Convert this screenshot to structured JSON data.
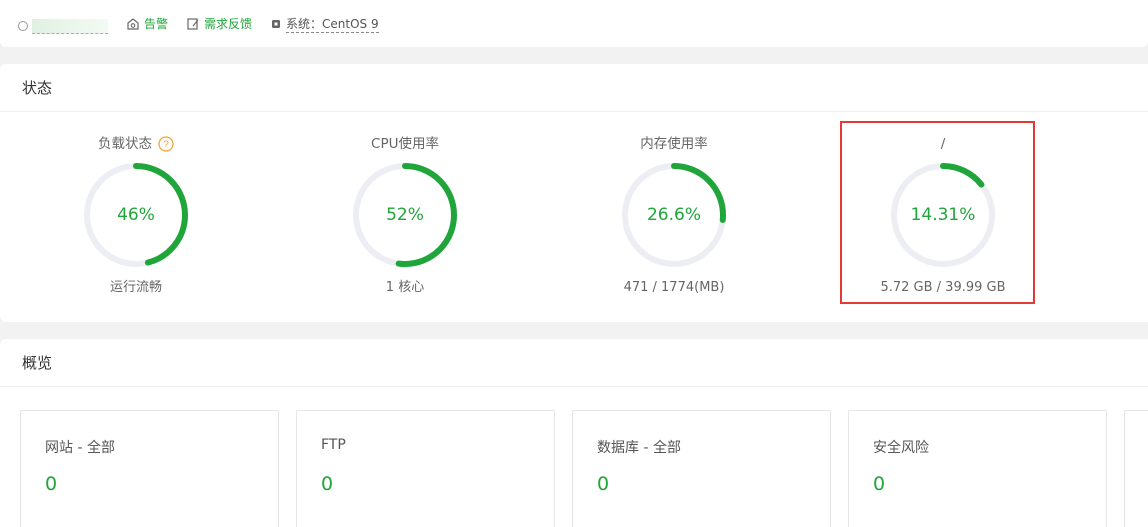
{
  "topbar": {
    "alarm_label": "告警",
    "feedback_label": "需求反馈",
    "system_label": "系统：CentOS 9"
  },
  "status": {
    "title": "状态",
    "gauges": [
      {
        "title": "负载状态",
        "value": "46%",
        "percent": 46,
        "sub": "运行流畅",
        "help": "?"
      },
      {
        "title": "CPU使用率",
        "value": "52%",
        "percent": 52,
        "sub": "1 核心"
      },
      {
        "title": "内存使用率",
        "value": "26.6%",
        "percent": 26.6,
        "sub": "471 / 1774(MB)"
      },
      {
        "title": "/",
        "value": "14.31%",
        "percent": 14.31,
        "sub": "5.72 GB / 39.99 GB"
      }
    ]
  },
  "overview": {
    "title": "概览",
    "cards": [
      {
        "title": "网站 - 全部",
        "value": "0"
      },
      {
        "title": "FTP",
        "value": "0"
      },
      {
        "title": "数据库 - 全部",
        "value": "0"
      },
      {
        "title": "安全风险",
        "value": "0"
      }
    ]
  },
  "colors": {
    "accent": "#20a53a",
    "ring_track": "#eceef4",
    "highlight": "#e23b36"
  }
}
